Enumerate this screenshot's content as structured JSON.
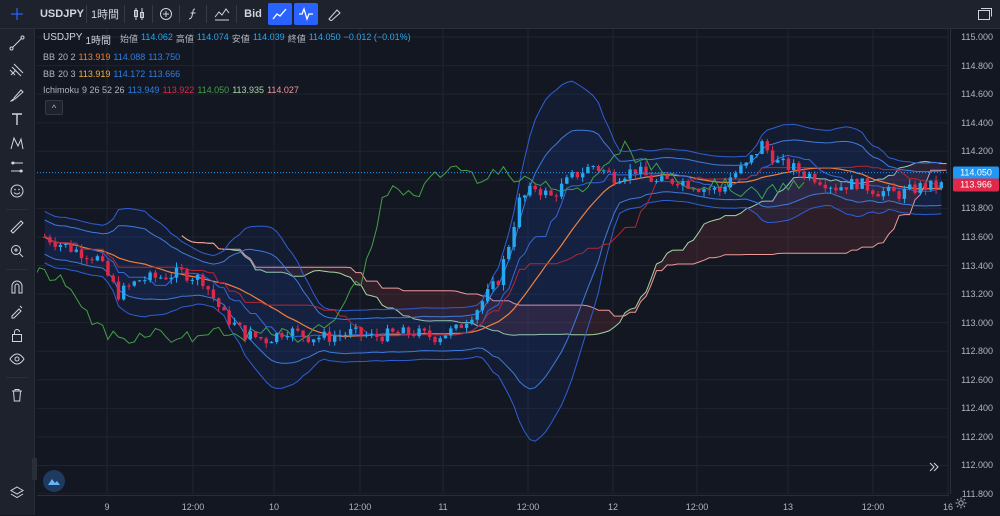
{
  "top_bar": {
    "symbol": "USDJPY",
    "interval": "1時間",
    "price_type": "Bid"
  },
  "legend": {
    "ohlc": {
      "symbol": "USDJPY",
      "interval": "1時間",
      "open_label": "始値",
      "open": "114.062",
      "high_label": "高値",
      "high": "114.074",
      "low_label": "安値",
      "low": "114.039",
      "close_label": "終値",
      "close": "114.050",
      "change": "−0.012 (−0.01%)"
    },
    "bb1": {
      "name": "BB",
      "params": "20 2",
      "v1": "113.919",
      "v2": "114.088",
      "v3": "113.750"
    },
    "bb2": {
      "name": "BB",
      "params": "20 3",
      "v1": "113.919",
      "v2": "114.172",
      "v3": "113.666"
    },
    "ichimoku": {
      "name": "Ichimoku",
      "params": "9 26 52 26",
      "v1": "113.949",
      "v2": "113.922",
      "v3": "114.050",
      "v4": "113.935",
      "v5": "114.027"
    },
    "collapse_glyph": "^"
  },
  "price_axis": {
    "labels": [
      "115.000",
      "114.800",
      "114.600",
      "114.400",
      "114.200",
      "114.000",
      "113.800",
      "113.600",
      "113.400",
      "113.200",
      "113.000",
      "112.800",
      "112.600",
      "112.400",
      "112.200",
      "112.000",
      "111.800"
    ],
    "current_price": "114.050",
    "kijun_tag": "113.966"
  },
  "time_axis": {
    "labels": [
      "9",
      "12:00",
      "10",
      "12:00",
      "11",
      "12:00",
      "12",
      "12:00",
      "13",
      "12:00",
      "16"
    ]
  },
  "colors": {
    "up": "#26a7f0",
    "down": "#e0294a",
    "bb_mid": "#f0803c",
    "bb_band": "#2f5fd6",
    "tenkan": "#2962ff",
    "kijun": "#b22833",
    "chikou": "#43a047",
    "span_a": "#a5d6a7",
    "span_b": "#ef9a9a",
    "current": "#2196f3"
  },
  "chart_data": {
    "type": "candlestick",
    "symbol": "USDJPY",
    "ylim": [
      111.8,
      115.0
    ],
    "series": [
      {
        "name": "BB 20 2"
      },
      {
        "name": "BB 20 3"
      },
      {
        "name": "Ichimoku 9 26 52 26"
      }
    ],
    "close_path": [
      [
        0,
        113.6
      ],
      [
        5,
        113.52
      ],
      [
        10,
        113.45
      ],
      [
        14,
        113.2
      ],
      [
        18,
        113.3
      ],
      [
        22,
        113.32
      ],
      [
        26,
        113.35
      ],
      [
        30,
        113.3
      ],
      [
        34,
        113.05
      ],
      [
        38,
        112.92
      ],
      [
        42,
        112.88
      ],
      [
        46,
        112.95
      ],
      [
        50,
        112.9
      ],
      [
        54,
        112.9
      ],
      [
        58,
        112.93
      ],
      [
        62,
        112.9
      ],
      [
        66,
        112.92
      ],
      [
        70,
        112.93
      ],
      [
        74,
        112.9
      ],
      [
        78,
        112.95
      ],
      [
        82,
        113.1
      ],
      [
        86,
        113.3
      ],
      [
        88,
        113.55
      ],
      [
        90,
        113.85
      ],
      [
        93,
        113.95
      ],
      [
        96,
        113.88
      ],
      [
        100,
        114.02
      ],
      [
        104,
        114.1
      ],
      [
        108,
        114.02
      ],
      [
        112,
        114.07
      ],
      [
        116,
        113.98
      ],
      [
        120,
        114.0
      ],
      [
        124,
        113.95
      ],
      [
        128,
        113.92
      ],
      [
        130,
        114.02
      ],
      [
        133,
        114.1
      ],
      [
        136,
        114.25
      ],
      [
        139,
        114.12
      ],
      [
        142,
        114.08
      ],
      [
        146,
        114.02
      ],
      [
        150,
        113.95
      ],
      [
        154,
        113.98
      ],
      [
        158,
        113.92
      ],
      [
        162,
        113.9
      ],
      [
        166,
        113.95
      ],
      [
        170,
        113.96
      ]
    ]
  }
}
